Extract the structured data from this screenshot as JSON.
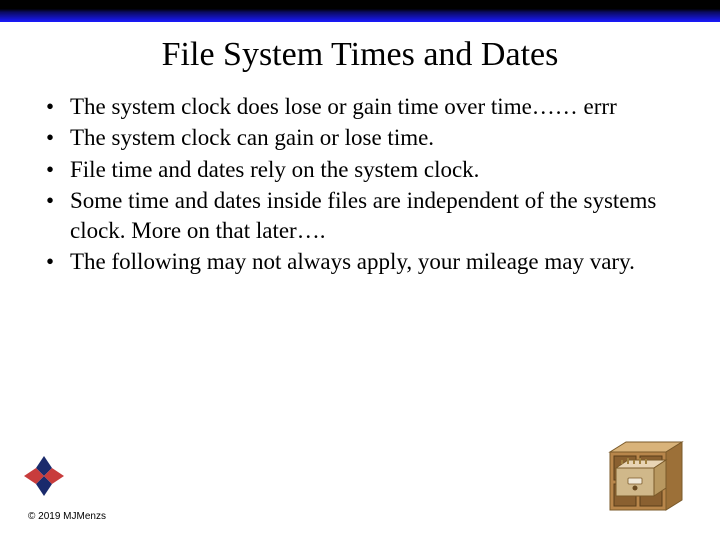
{
  "title": "File System Times and Dates",
  "bullets": [
    "The system clock does lose or gain time over time…… errr",
    "The system clock can gain or lose time.",
    "File time and dates rely on the system clock.",
    "Some time and dates inside files are independent of the systems clock. More on that later….",
    "The following may not always apply, your mileage may vary."
  ],
  "copyright": "© 2019 MJMenzs",
  "colors": {
    "bar_dark": "#000000",
    "bar_blue": "#1a1aff",
    "logo_navy": "#1a2a6c",
    "logo_red": "#c83c3c",
    "cabinet_wood": "#b8864b",
    "cabinet_top": "#d9b37a",
    "cabinet_drawer": "#e8d5b5"
  }
}
